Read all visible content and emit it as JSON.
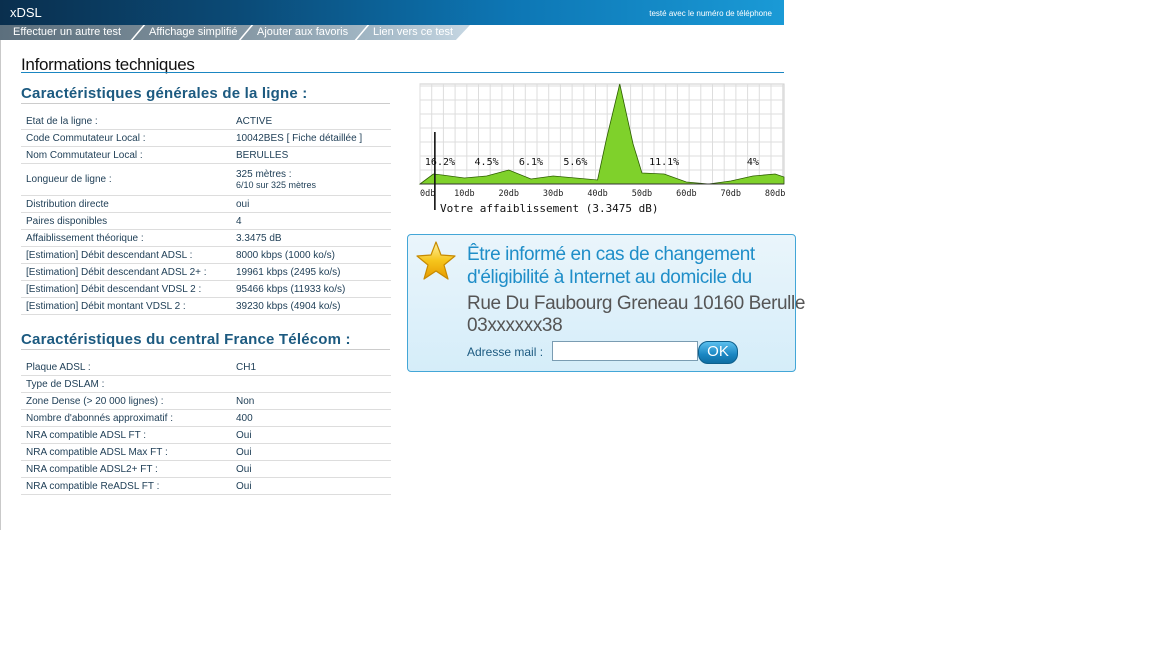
{
  "header": {
    "title": "xDSL",
    "note": "testé avec le numéro de téléphone"
  },
  "nav": {
    "tabs": [
      {
        "label": "Effectuer un autre test"
      },
      {
        "label": "Affichage simplifié"
      },
      {
        "label": "Ajouter aux favoris"
      },
      {
        "label": "Lien vers ce test"
      }
    ]
  },
  "main": {
    "title": "Informations techniques"
  },
  "line": {
    "heading": "Caractéristiques générales de la ligne :",
    "rows": [
      {
        "label": "Etat de la ligne :",
        "value": "ACTIVE"
      },
      {
        "label": "Code Commutateur Local :",
        "value": "10042BES",
        "link": "[ Fiche détaillée ]"
      },
      {
        "label": "Nom Commutateur Local :",
        "value": "BERULLES"
      },
      {
        "label": "Longueur de ligne :",
        "value": "325 mètres :",
        "value2": "6/10 sur 325 mètres"
      },
      {
        "label": "Distribution directe",
        "value": "oui"
      },
      {
        "label": "Paires disponibles",
        "value": "4"
      },
      {
        "label": "Affaiblissement théorique :",
        "value": "3.3475 dB"
      },
      {
        "label": "[Estimation] Débit descendant ADSL :",
        "value": "8000 kbps (1000 ko/s)"
      },
      {
        "label": "[Estimation] Débit descendant ADSL 2+ :",
        "value": "19961 kbps (2495 ko/s)"
      },
      {
        "label": "[Estimation] Débit descendant VDSL 2 :",
        "value": "95466 kbps (11933 ko/s)"
      },
      {
        "label": "[Estimation] Débit montant VDSL 2 :",
        "value": "39230 kbps (4904 ko/s)"
      }
    ]
  },
  "central": {
    "heading": "Caractéristiques du central France Télécom :",
    "rows": [
      {
        "label": "Plaque ADSL :",
        "value": "CH1"
      },
      {
        "label": "Type de DSLAM :",
        "value": ""
      },
      {
        "label": "Zone Dense (> 20 000 lignes) :",
        "value": "Non"
      },
      {
        "label": "Nombre d'abonnés approximatif :",
        "value": "400"
      },
      {
        "label": "NRA compatible ADSL FT :",
        "value": "Oui"
      },
      {
        "label": "NRA compatible ADSL Max FT :",
        "value": "Oui"
      },
      {
        "label": "NRA compatible ADSL2+ FT :",
        "value": "Oui"
      },
      {
        "label": "NRA compatible ReADSL FT :",
        "value": "Oui"
      }
    ]
  },
  "chart_data": {
    "type": "area",
    "x_ticks": [
      "0db",
      "10db",
      "20db",
      "30db",
      "40db",
      "50db",
      "60db",
      "70db",
      "80db"
    ],
    "xlim": [
      0,
      82
    ],
    "ylim": [
      0,
      100
    ],
    "grid": true,
    "fill_color": "#7fd12b",
    "x": [
      0,
      3,
      5,
      10,
      15,
      20,
      25,
      30,
      35,
      40,
      42,
      45,
      48,
      50,
      55,
      60,
      65,
      70,
      75,
      80,
      82
    ],
    "y": [
      0,
      10,
      9,
      6,
      8,
      14,
      5,
      8,
      6,
      4,
      45,
      100,
      40,
      11,
      10,
      2,
      0,
      3,
      8,
      10,
      7
    ],
    "annotations": [
      {
        "x": 4.5,
        "text": "16.2%"
      },
      {
        "x": 15,
        "text": "4.5%"
      },
      {
        "x": 25,
        "text": "6.1%"
      },
      {
        "x": 35,
        "text": "5.6%"
      },
      {
        "x": 55,
        "text": "11.1%"
      },
      {
        "x": 75,
        "text": "4%"
      }
    ],
    "marker_x": 3.3475,
    "caption": "Votre affaiblissement (3.3475 dB)"
  },
  "alert": {
    "line1": "Être informé en cas de changement",
    "line2": "d'éligibilité à Internet au domicile du",
    "address": "Rue Du Faubourg Greneau 10160 Berulle",
    "phone": "03xxxxxx38",
    "mail_label": "Adresse mail :",
    "mail_value": "",
    "mail_placeholder": "",
    "ok_label": "OK"
  },
  "colors": {
    "accent": "#1a86c2",
    "heading": "#1c5a80",
    "chart_fill": "#7fd12b"
  }
}
